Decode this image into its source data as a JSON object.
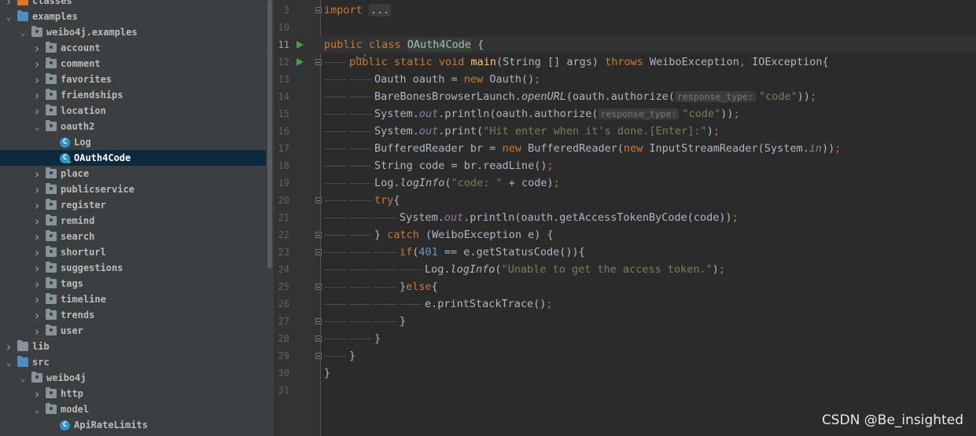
{
  "tree": [
    {
      "label": "classes",
      "depth": 0,
      "arrow": "right",
      "icon": "folder-exc"
    },
    {
      "label": "examples",
      "depth": 0,
      "arrow": "down",
      "icon": "folder-src"
    },
    {
      "label": "weibo4j.examples",
      "depth": 1,
      "arrow": "down",
      "icon": "folder-pkg"
    },
    {
      "label": "account",
      "depth": 2,
      "arrow": "right",
      "icon": "folder-pkg"
    },
    {
      "label": "comment",
      "depth": 2,
      "arrow": "right",
      "icon": "folder-pkg"
    },
    {
      "label": "favorites",
      "depth": 2,
      "arrow": "right",
      "icon": "folder-pkg"
    },
    {
      "label": "friendships",
      "depth": 2,
      "arrow": "right",
      "icon": "folder-pkg"
    },
    {
      "label": "location",
      "depth": 2,
      "arrow": "right",
      "icon": "folder-pkg"
    },
    {
      "label": "oauth2",
      "depth": 2,
      "arrow": "down",
      "icon": "folder-pkg"
    },
    {
      "label": "Log",
      "depth": 3,
      "arrow": "",
      "icon": "class"
    },
    {
      "label": "OAuth4Code",
      "depth": 3,
      "arrow": "",
      "icon": "class-run",
      "selected": true
    },
    {
      "label": "place",
      "depth": 2,
      "arrow": "right",
      "icon": "folder-pkg"
    },
    {
      "label": "publicservice",
      "depth": 2,
      "arrow": "right",
      "icon": "folder-pkg"
    },
    {
      "label": "register",
      "depth": 2,
      "arrow": "right",
      "icon": "folder-pkg"
    },
    {
      "label": "remind",
      "depth": 2,
      "arrow": "right",
      "icon": "folder-pkg"
    },
    {
      "label": "search",
      "depth": 2,
      "arrow": "right",
      "icon": "folder-pkg"
    },
    {
      "label": "shorturl",
      "depth": 2,
      "arrow": "right",
      "icon": "folder-pkg"
    },
    {
      "label": "suggestions",
      "depth": 2,
      "arrow": "right",
      "icon": "folder-pkg"
    },
    {
      "label": "tags",
      "depth": 2,
      "arrow": "right",
      "icon": "folder-pkg"
    },
    {
      "label": "timeline",
      "depth": 2,
      "arrow": "right",
      "icon": "folder-pkg"
    },
    {
      "label": "trends",
      "depth": 2,
      "arrow": "right",
      "icon": "folder-pkg"
    },
    {
      "label": "user",
      "depth": 2,
      "arrow": "right",
      "icon": "folder-pkg"
    },
    {
      "label": "lib",
      "depth": 0,
      "arrow": "right",
      "icon": "folder"
    },
    {
      "label": "src",
      "depth": 0,
      "arrow": "down",
      "icon": "folder-src"
    },
    {
      "label": "weibo4j",
      "depth": 1,
      "arrow": "down",
      "icon": "folder-pkg"
    },
    {
      "label": "http",
      "depth": 2,
      "arrow": "right",
      "icon": "folder-pkg"
    },
    {
      "label": "model",
      "depth": 2,
      "arrow": "down",
      "icon": "folder-pkg"
    },
    {
      "label": "ApiRateLimits",
      "depth": 3,
      "arrow": "",
      "icon": "class"
    }
  ],
  "class_icon_letter": "C",
  "editor": {
    "current_line": "11",
    "author_hint": "✁˅",
    "lines": [
      {
        "n": "3",
        "fold": true,
        "run": false,
        "indent": 0,
        "tokens": [
          {
            "t": "import ",
            "c": "kw"
          },
          {
            "t": "...",
            "c": "fold-ph"
          }
        ]
      },
      {
        "n": "10",
        "fold": false,
        "run": false,
        "indent": 0,
        "tokens": []
      },
      {
        "n": "11",
        "fold": false,
        "run": true,
        "indent": 0,
        "tokens": [
          {
            "t": "public ",
            "c": "kw"
          },
          {
            "t": "class ",
            "c": "kw"
          },
          {
            "t": "OAuth4Code",
            "c": "cls-hl"
          },
          {
            "t": " {",
            "c": ""
          }
        ]
      },
      {
        "n": "12",
        "fold": true,
        "run": true,
        "indent": 1,
        "tokens": [
          {
            "t": "public ",
            "c": "kw"
          },
          {
            "t": "static ",
            "c": "kw"
          },
          {
            "t": "void ",
            "c": "kw"
          },
          {
            "t": "main",
            "c": "fn"
          },
          {
            "t": "(String [] args) ",
            "c": ""
          },
          {
            "t": "throws ",
            "c": "kw"
          },
          {
            "t": "WeiboException",
            "c": ""
          },
          {
            "t": ", ",
            "c": "kw"
          },
          {
            "t": "IOException{",
            "c": ""
          }
        ]
      },
      {
        "n": "13",
        "fold": false,
        "run": false,
        "indent": 2,
        "tokens": [
          {
            "t": "Oauth oauth = ",
            "c": ""
          },
          {
            "t": "new ",
            "c": "kw"
          },
          {
            "t": "Oauth()",
            "c": ""
          },
          {
            "t": ";",
            "c": "kw"
          }
        ]
      },
      {
        "n": "14",
        "fold": false,
        "run": false,
        "indent": 2,
        "tokens": [
          {
            "t": "BareBonesBrowserLaunch.",
            "c": ""
          },
          {
            "t": "openURL",
            "c": "itl"
          },
          {
            "t": "(oauth.authorize(",
            "c": ""
          },
          {
            "t": "response_type:",
            "c": "hint"
          },
          {
            "t": "\"code\"",
            "c": "str"
          },
          {
            "t": "))",
            "c": ""
          },
          {
            "t": ";",
            "c": "kw"
          }
        ]
      },
      {
        "n": "15",
        "fold": false,
        "run": false,
        "indent": 2,
        "tokens": [
          {
            "t": "System.",
            "c": ""
          },
          {
            "t": "out",
            "c": "fld"
          },
          {
            "t": ".println(oauth.authorize(",
            "c": ""
          },
          {
            "t": "response_type:",
            "c": "hint"
          },
          {
            "t": "\"code\"",
            "c": "str"
          },
          {
            "t": "))",
            "c": ""
          },
          {
            "t": ";",
            "c": "kw"
          }
        ]
      },
      {
        "n": "16",
        "fold": false,
        "run": false,
        "indent": 2,
        "tokens": [
          {
            "t": "System.",
            "c": ""
          },
          {
            "t": "out",
            "c": "fld"
          },
          {
            "t": ".print(",
            "c": ""
          },
          {
            "t": "\"Hit enter when it's done.[Enter]:\"",
            "c": "str"
          },
          {
            "t": ")",
            "c": ""
          },
          {
            "t": ";",
            "c": "kw"
          }
        ]
      },
      {
        "n": "17",
        "fold": false,
        "run": false,
        "indent": 2,
        "tokens": [
          {
            "t": "BufferedReader br = ",
            "c": ""
          },
          {
            "t": "new ",
            "c": "kw"
          },
          {
            "t": "BufferedReader(",
            "c": ""
          },
          {
            "t": "new ",
            "c": "kw"
          },
          {
            "t": "InputStreamReader(System.",
            "c": ""
          },
          {
            "t": "in",
            "c": "fld"
          },
          {
            "t": "))",
            "c": ""
          },
          {
            "t": ";",
            "c": "kw"
          }
        ]
      },
      {
        "n": "18",
        "fold": false,
        "run": false,
        "indent": 2,
        "tokens": [
          {
            "t": "String code = br.readLine()",
            "c": ""
          },
          {
            "t": ";",
            "c": "kw"
          }
        ]
      },
      {
        "n": "19",
        "fold": false,
        "run": false,
        "indent": 2,
        "tokens": [
          {
            "t": "Log.",
            "c": ""
          },
          {
            "t": "logInfo",
            "c": "itl"
          },
          {
            "t": "(",
            "c": ""
          },
          {
            "t": "\"code: \"",
            "c": "str"
          },
          {
            "t": " + code)",
            "c": ""
          },
          {
            "t": ";",
            "c": "kw"
          }
        ]
      },
      {
        "n": "20",
        "fold": true,
        "run": false,
        "indent": 2,
        "tokens": [
          {
            "t": "try",
            "c": "kw"
          },
          {
            "t": "{",
            "c": ""
          }
        ]
      },
      {
        "n": "21",
        "fold": false,
        "run": false,
        "indent": 3,
        "tokens": [
          {
            "t": "System.",
            "c": ""
          },
          {
            "t": "out",
            "c": "fld"
          },
          {
            "t": ".println(oauth.getAccessTokenByCode(code))",
            "c": ""
          },
          {
            "t": ";",
            "c": "kw"
          }
        ]
      },
      {
        "n": "22",
        "fold": true,
        "run": false,
        "indent": 2,
        "tokens": [
          {
            "t": "} ",
            "c": ""
          },
          {
            "t": "catch ",
            "c": "kw"
          },
          {
            "t": "(WeiboException e) {",
            "c": ""
          }
        ]
      },
      {
        "n": "23",
        "fold": true,
        "run": false,
        "indent": 3,
        "tokens": [
          {
            "t": "if",
            "c": "kw"
          },
          {
            "t": "(",
            "c": ""
          },
          {
            "t": "401",
            "c": "num"
          },
          {
            "t": " == e.getStatusCode()){",
            "c": ""
          }
        ]
      },
      {
        "n": "24",
        "fold": false,
        "run": false,
        "indent": 4,
        "tokens": [
          {
            "t": "Log.",
            "c": ""
          },
          {
            "t": "logInfo",
            "c": "itl"
          },
          {
            "t": "(",
            "c": ""
          },
          {
            "t": "\"Unable to get the access token.\"",
            "c": "str"
          },
          {
            "t": ")",
            "c": ""
          },
          {
            "t": ";",
            "c": "kw"
          }
        ]
      },
      {
        "n": "25",
        "fold": true,
        "run": false,
        "indent": 3,
        "tokens": [
          {
            "t": "}",
            "c": ""
          },
          {
            "t": "else",
            "c": "kw"
          },
          {
            "t": "{",
            "c": ""
          }
        ]
      },
      {
        "n": "26",
        "fold": false,
        "run": false,
        "indent": 4,
        "tokens": [
          {
            "t": "e.printStackTrace()",
            "c": ""
          },
          {
            "t": ";",
            "c": "kw"
          }
        ]
      },
      {
        "n": "27",
        "fold": true,
        "run": false,
        "indent": 3,
        "tokens": [
          {
            "t": "}",
            "c": ""
          }
        ]
      },
      {
        "n": "28",
        "fold": true,
        "run": false,
        "indent": 2,
        "tokens": [
          {
            "t": "}",
            "c": ""
          }
        ]
      },
      {
        "n": "29",
        "fold": true,
        "run": false,
        "indent": 1,
        "tokens": [
          {
            "t": "}",
            "c": ""
          }
        ]
      },
      {
        "n": "30",
        "fold": false,
        "run": false,
        "indent": 0,
        "tokens": [
          {
            "t": "}",
            "c": ""
          }
        ]
      },
      {
        "n": "31",
        "fold": false,
        "run": false,
        "indent": 0,
        "tokens": []
      }
    ]
  },
  "watermark": "CSDN @Be_insighted",
  "colors": {
    "tree_bg": "#3c3f41",
    "editor_bg": "#2b2b2b",
    "gutter_bg": "#313335",
    "selected_row": "#0d293e",
    "keyword": "#cc7832",
    "string": "#6a8759",
    "number": "#6897bb",
    "method": "#ffc66d",
    "field": "#9876aa",
    "text": "#a9b7c6",
    "run_marker": "#499c54"
  }
}
